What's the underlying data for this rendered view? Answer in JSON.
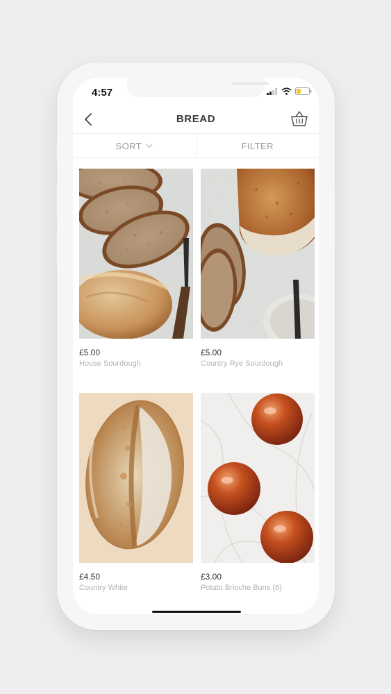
{
  "status_bar": {
    "time": "4:57"
  },
  "header": {
    "title": "BREAD"
  },
  "toolbar": {
    "sort_label": "SORT",
    "filter_label": "FILTER"
  },
  "products": [
    {
      "price": "£5.00",
      "name": "House Sourdough"
    },
    {
      "price": "£5.00",
      "name": "Country Rye Sourdough"
    },
    {
      "price": "£4.50",
      "name": "Country White"
    },
    {
      "price": "£3.00",
      "name": "Potato Brioche Buns (6)"
    }
  ],
  "colors": {
    "background": "#eeeef0",
    "title_text": "#3a3a3a",
    "muted_text": "#9a9a9e",
    "battery": "#f3c93c"
  },
  "icons": [
    "back-chevron-icon",
    "basket-icon",
    "sort-chevron-down-icon",
    "signal-icon",
    "wifi-icon",
    "battery-icon"
  ]
}
